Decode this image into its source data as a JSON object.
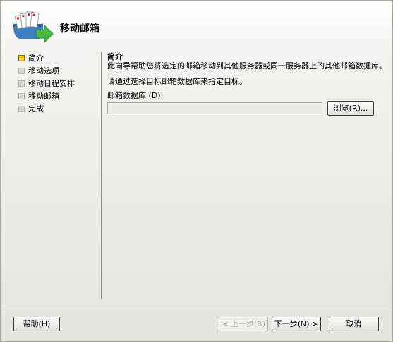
{
  "header": {
    "title": "移动邮箱",
    "icon": "mailbox-move-icon"
  },
  "steps": [
    {
      "label": "简介",
      "state": "current"
    },
    {
      "label": "移动选项",
      "state": "pending"
    },
    {
      "label": "移动日程安排",
      "state": "pending"
    },
    {
      "label": "移动邮箱",
      "state": "pending"
    },
    {
      "label": "完成",
      "state": "pending"
    }
  ],
  "content": {
    "section_title": "简介",
    "description": "此向导帮助您将选定的邮箱移动到其他服务器或同一服务器上的其他邮箱数据库。",
    "instruction": "请通过选择目标邮箱数据库来指定目标。",
    "field_label": "邮箱数据库 (D):",
    "field_value": "",
    "browse_label": "浏览(R)..."
  },
  "buttons": {
    "help": "帮助(H)",
    "back": "< 上一步(B)",
    "next": "下一步(N) >",
    "cancel": "取消"
  },
  "colors": {
    "current_step": "#f0c419",
    "pending_step": "#d7d6d2",
    "disabled_text": "#a6a5a0"
  }
}
